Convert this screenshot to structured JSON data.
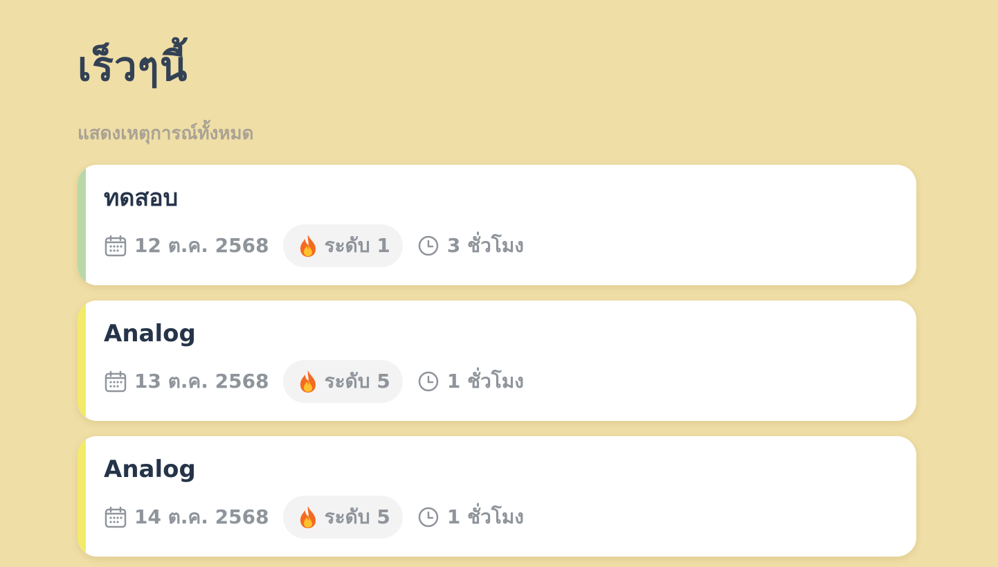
{
  "page": {
    "title": "เร็วๆนี้",
    "subtitle": "แสดงเหตุการณ์ทั้งหมด"
  },
  "cards": [
    {
      "title": "ทดสอบ",
      "date": "12 ต.ค. 2568",
      "level": "ระดับ 1",
      "duration": "3 ชั่วโมง",
      "accent": "#b8d8a8"
    },
    {
      "title": "Analog",
      "date": "13 ต.ค. 2568",
      "level": "ระดับ 5",
      "duration": "1 ชั่วโมง",
      "accent": "#f4ea6a"
    },
    {
      "title": "Analog",
      "date": "14 ต.ค. 2568",
      "level": "ระดับ 5",
      "duration": "1 ชั่วโมง",
      "accent": "#f4ea6a"
    }
  ],
  "icons": {
    "calendar": "calendar-icon",
    "level": "fire-icon",
    "duration": "clock-icon"
  }
}
